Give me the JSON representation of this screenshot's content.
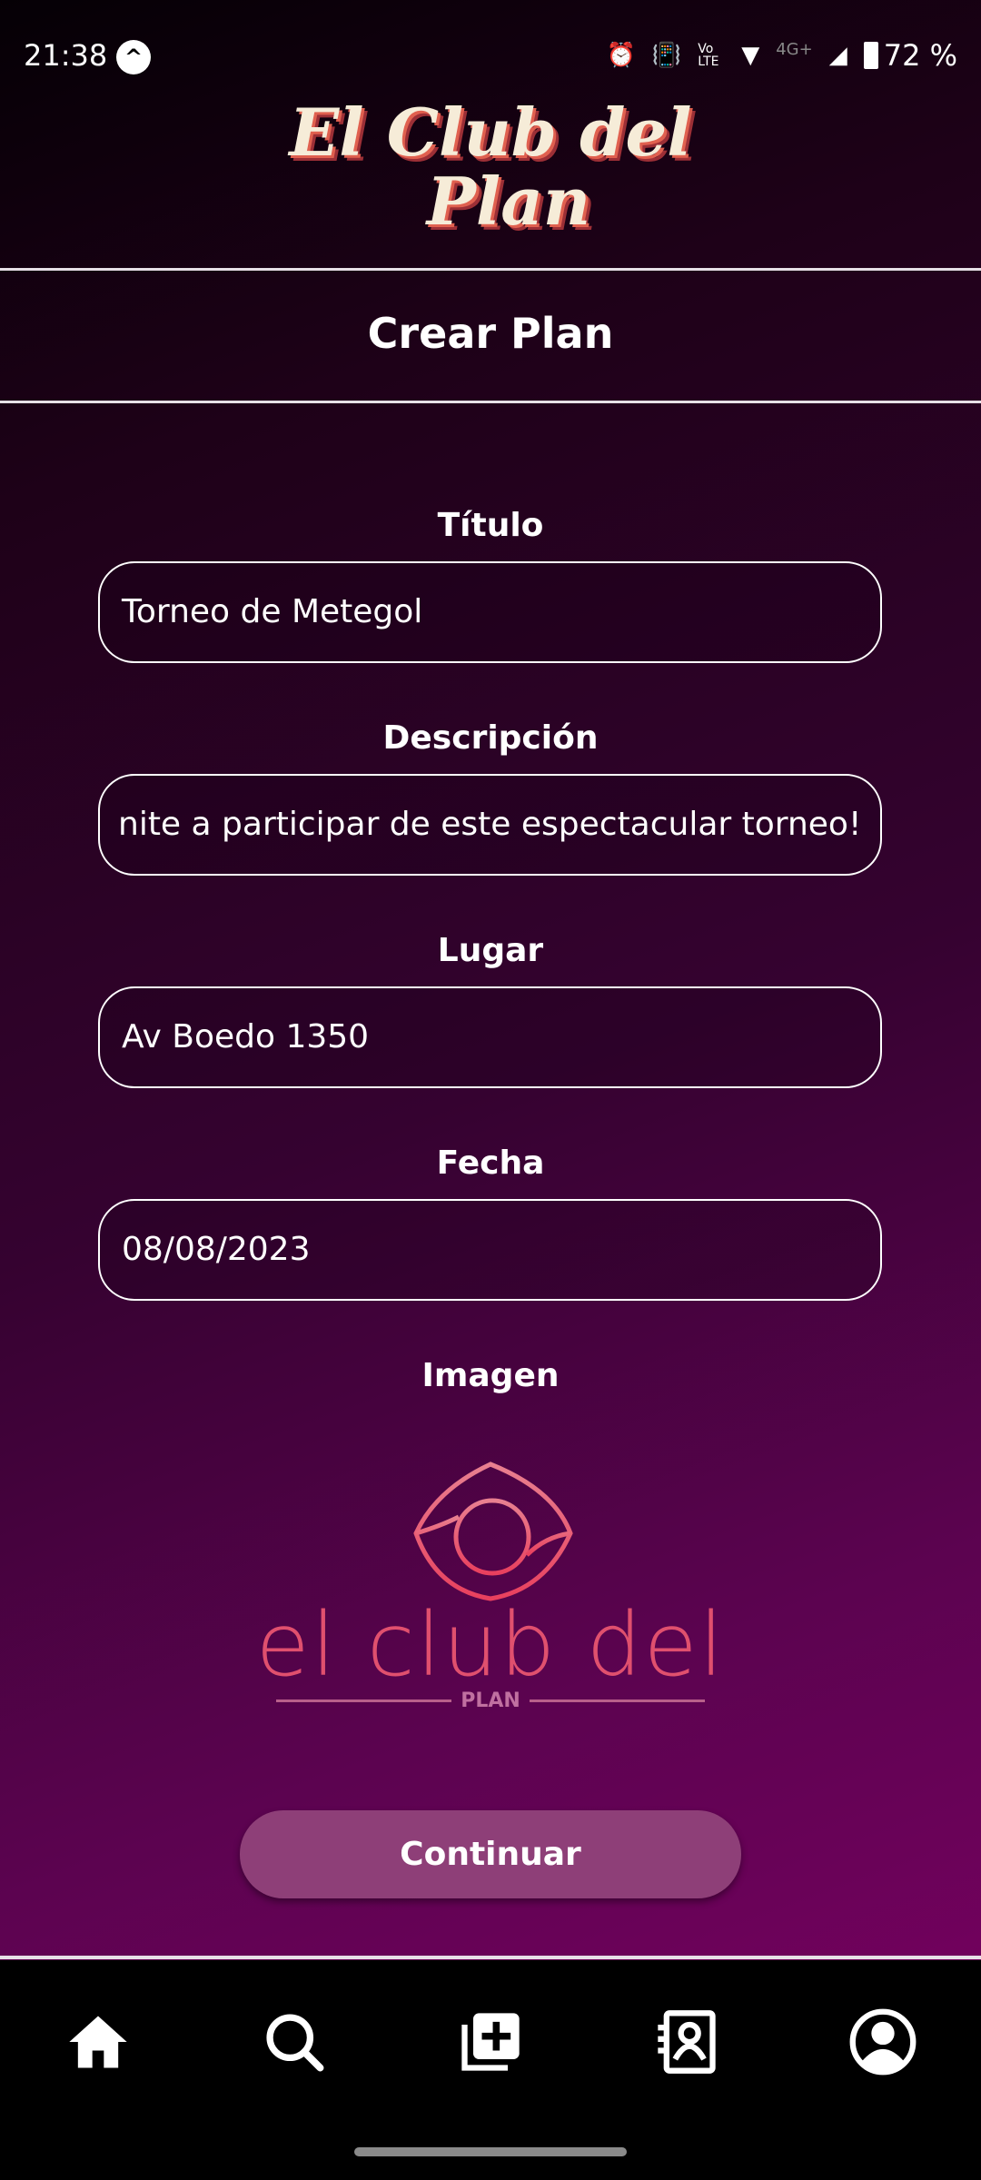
{
  "status_bar": {
    "time": "21:38",
    "battery": "72 %",
    "network": "4G+",
    "volte": "Vo LTE"
  },
  "header": {
    "app_logo_text": "El Club del Plan",
    "page_title": "Crear Plan"
  },
  "form": {
    "fields": [
      {
        "label": "Título",
        "value": "Torneo de Metegol"
      },
      {
        "label": "Descripción",
        "value": "nite a participar de este espectacular torneo!"
      },
      {
        "label": "Lugar",
        "value": "Av Boedo 1350"
      },
      {
        "label": "Fecha",
        "value": "08/08/2023"
      }
    ],
    "image_label": "Imagen",
    "image_logo_text": "el club del",
    "image_logo_sub": "PLAN",
    "submit_label": "Continuar"
  },
  "nav": {
    "items": [
      "home-icon",
      "search-icon",
      "add-plan-icon",
      "contacts-icon",
      "profile-icon"
    ]
  },
  "colors": {
    "button": "#8e3f78",
    "logo_pink": "#e8506e",
    "background_end": "#7c0063"
  }
}
